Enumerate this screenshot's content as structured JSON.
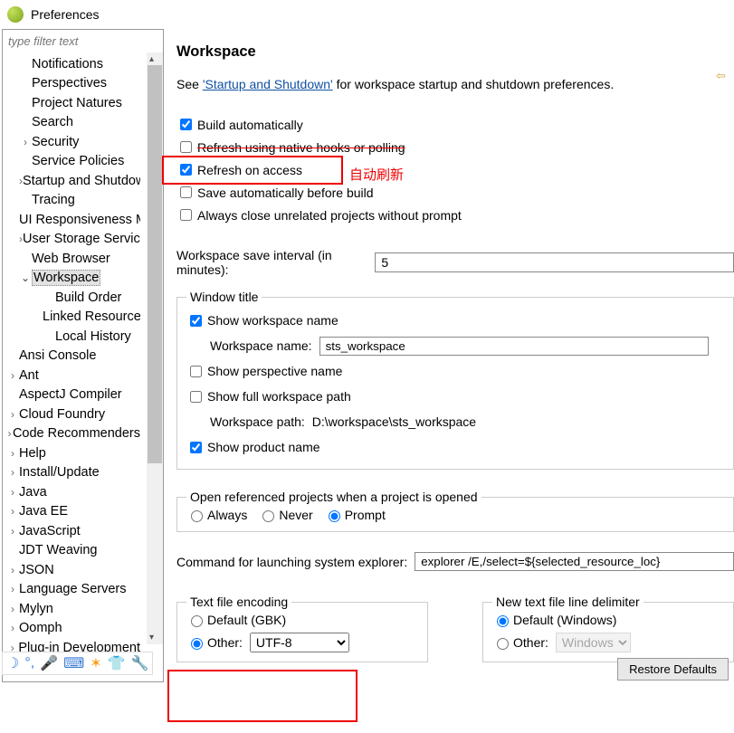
{
  "window": {
    "title": "Preferences"
  },
  "filter": {
    "placeholder": "type filter text"
  },
  "tree": [
    {
      "lvl": 1,
      "arrow": "",
      "label": "Notifications"
    },
    {
      "lvl": 1,
      "arrow": "",
      "label": "Perspectives"
    },
    {
      "lvl": 1,
      "arrow": "",
      "label": "Project Natures"
    },
    {
      "lvl": 1,
      "arrow": "",
      "label": "Search"
    },
    {
      "lvl": 1,
      "arrow": ">",
      "label": "Security"
    },
    {
      "lvl": 1,
      "arrow": "",
      "label": "Service Policies"
    },
    {
      "lvl": 1,
      "arrow": ">",
      "label": "Startup and Shutdown"
    },
    {
      "lvl": 1,
      "arrow": "",
      "label": "Tracing"
    },
    {
      "lvl": 1,
      "arrow": "",
      "label": "UI Responsiveness Monitoring"
    },
    {
      "lvl": 1,
      "arrow": ">",
      "label": "User Storage Service"
    },
    {
      "lvl": 1,
      "arrow": "",
      "label": "Web Browser"
    },
    {
      "lvl": 1,
      "arrow": "v",
      "label": "Workspace",
      "selected": true
    },
    {
      "lvl": 2,
      "arrow": "",
      "label": "Build Order"
    },
    {
      "lvl": 2,
      "arrow": "",
      "label": "Linked Resources"
    },
    {
      "lvl": 2,
      "arrow": "",
      "label": "Local History"
    },
    {
      "lvl": 0,
      "arrow": "",
      "label": "Ansi Console"
    },
    {
      "lvl": 0,
      "arrow": ">",
      "label": "Ant"
    },
    {
      "lvl": 0,
      "arrow": "",
      "label": "AspectJ Compiler"
    },
    {
      "lvl": 0,
      "arrow": ">",
      "label": "Cloud Foundry"
    },
    {
      "lvl": 0,
      "arrow": ">",
      "label": "Code Recommenders"
    },
    {
      "lvl": 0,
      "arrow": ">",
      "label": "Help"
    },
    {
      "lvl": 0,
      "arrow": ">",
      "label": "Install/Update"
    },
    {
      "lvl": 0,
      "arrow": ">",
      "label": "Java"
    },
    {
      "lvl": 0,
      "arrow": ">",
      "label": "Java EE"
    },
    {
      "lvl": 0,
      "arrow": ">",
      "label": "JavaScript"
    },
    {
      "lvl": 0,
      "arrow": "",
      "label": "JDT Weaving"
    },
    {
      "lvl": 0,
      "arrow": ">",
      "label": "JSON"
    },
    {
      "lvl": 0,
      "arrow": ">",
      "label": "Language Servers"
    },
    {
      "lvl": 0,
      "arrow": ">",
      "label": "Mylyn"
    },
    {
      "lvl": 0,
      "arrow": ">",
      "label": "Oomph"
    },
    {
      "lvl": 0,
      "arrow": ">",
      "label": "Plug-in Development"
    }
  ],
  "page": {
    "title": "Workspace",
    "intro_pre": "See ",
    "intro_link": "'Startup and Shutdown'",
    "intro_post": " for workspace startup and shutdown preferences.",
    "checks": {
      "build_auto": "Build automatically",
      "refresh_native": "Refresh using native hooks or polling",
      "refresh_access": "Refresh on access",
      "save_auto": "Save automatically before build",
      "close_unrelated": "Always close unrelated projects without prompt"
    },
    "annotation": "自动刷新",
    "save_interval_label": "Workspace save interval (in minutes):",
    "save_interval_value": "5",
    "window_title": {
      "legend": "Window title",
      "show_ws_name": "Show workspace name",
      "ws_name_label": "Workspace name:",
      "ws_name_value": "sts_workspace",
      "show_persp": "Show perspective name",
      "show_path": "Show full workspace path",
      "ws_path_label": "Workspace path:",
      "ws_path_value": "D:\\workspace\\sts_workspace",
      "show_product": "Show product name"
    },
    "open_ref": {
      "legend": "Open referenced projects when a project is opened",
      "always": "Always",
      "never": "Never",
      "prompt": "Prompt"
    },
    "cmd_label": "Command for launching system explorer:",
    "cmd_value": "explorer /E,/select=${selected_resource_loc}",
    "encoding": {
      "legend": "Text file encoding",
      "default": "Default (GBK)",
      "other": "Other:",
      "other_value": "UTF-8"
    },
    "delimiter": {
      "legend": "New text file line delimiter",
      "default": "Default (Windows)",
      "other": "Other:",
      "other_value": "Windows"
    },
    "restore": "Restore Defaults"
  }
}
